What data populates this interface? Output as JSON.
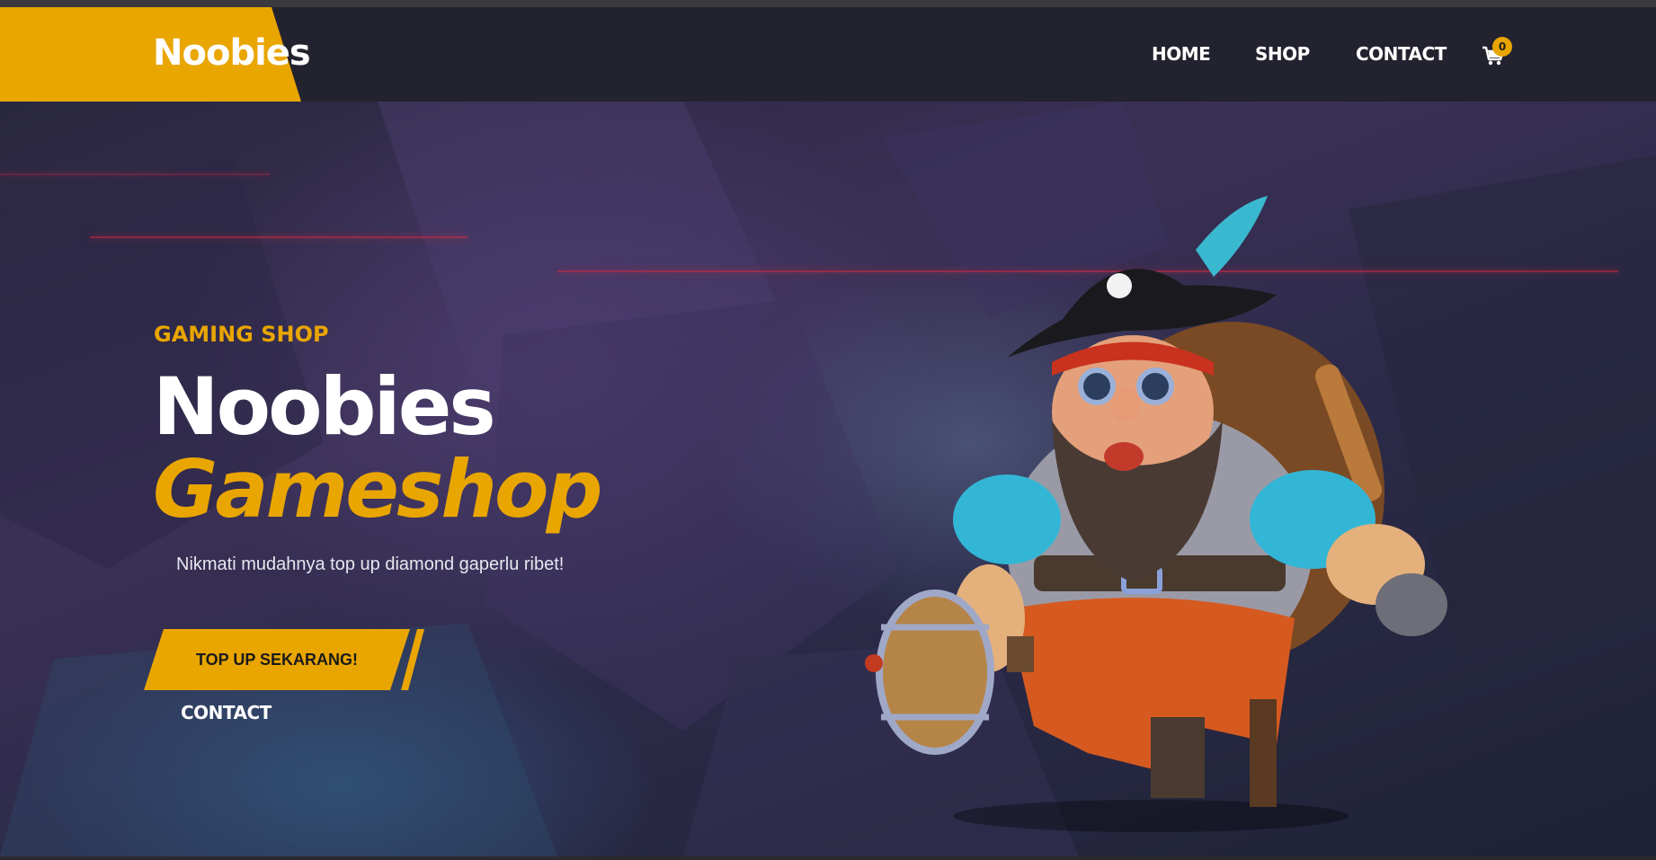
{
  "header": {
    "brand": "Noobies",
    "nav": {
      "home": "HOME",
      "shop": "SHOP",
      "contact": "CONTACT"
    },
    "cart_count": "0",
    "cart_icon": "cart-icon"
  },
  "hero": {
    "eyebrow": "GAMING SHOP",
    "title_line1": "Noobies",
    "title_line2": "Gameshop",
    "tagline": "Nikmati mudahnya top up diamond gaperlu ribet!",
    "cta_label": "TOP UP SEKARANG!",
    "contact_link": "CONTACT"
  },
  "colors": {
    "accent": "#e9a500",
    "header_bg": "#22232f",
    "text": "#ffffff"
  }
}
